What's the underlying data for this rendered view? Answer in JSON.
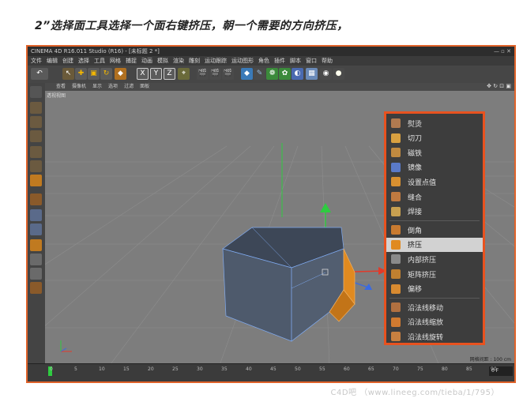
{
  "caption": "2”选择面工具选择一个面右键挤压，朝一个需要的方向挤压，",
  "window": {
    "title": "CINEMA 4D R16.011 Studio (R16) - [未标题 2 *]",
    "controls": "— ▫ ✕"
  },
  "menubar": [
    "文件",
    "编辑",
    "创建",
    "选择",
    "工具",
    "网格",
    "捕捉",
    "动画",
    "模拟",
    "渲染",
    "雕刻",
    "运动跟踪",
    "运动图形",
    "角色",
    "插件",
    "脚本",
    "窗口",
    "帮助"
  ],
  "toolbar": {
    "axis_x": "X",
    "axis_y": "Y",
    "axis_z": "Z"
  },
  "viewport": {
    "menu": [
      "查看",
      "摄像机",
      "显示",
      "选项",
      "过滤",
      "面板"
    ],
    "tag": "透视视图",
    "grid_label": "网格间距 : 100 cm",
    "nav_icons": "✥ ↻ ⊡ ▣"
  },
  "timeline": {
    "ticks": [
      "0",
      "5",
      "10",
      "15",
      "20",
      "25",
      "30",
      "35",
      "40",
      "45",
      "50",
      "55",
      "60",
      "65",
      "70",
      "75",
      "80",
      "85",
      "90"
    ],
    "frame_field": "0 F"
  },
  "context_menu": {
    "groups": [
      [
        {
          "label": "熨烫",
          "icon": "iron-icon"
        },
        {
          "label": "切刀",
          "icon": "knife-icon"
        },
        {
          "label": "磁铁",
          "icon": "magnet-icon"
        },
        {
          "label": "镜像",
          "icon": "mirror-icon"
        },
        {
          "label": "设置点值",
          "icon": "set-point-value-icon"
        },
        {
          "label": "缝合",
          "icon": "stitch-icon"
        },
        {
          "label": "焊接",
          "icon": "weld-icon"
        }
      ],
      [
        {
          "label": "倒角",
          "icon": "bevel-icon"
        },
        {
          "label": "挤压",
          "icon": "extrude-icon",
          "selected": true
        },
        {
          "label": "内部挤压",
          "icon": "extrude-inner-icon"
        },
        {
          "label": "矩阵挤压",
          "icon": "matrix-extrude-icon"
        },
        {
          "label": "偏移",
          "icon": "offset-icon"
        }
      ],
      [
        {
          "label": "沿法线移动",
          "icon": "normal-move-icon"
        },
        {
          "label": "沿法线缩放",
          "icon": "normal-scale-icon"
        },
        {
          "label": "沿法线旋转",
          "icon": "normal-rotate-icon"
        }
      ]
    ]
  },
  "watermark": "C4D吧 （www.lineeg.com/tieba/1/795）",
  "colors": {
    "highlight_border": "#e8521f",
    "frame_border": "#e0632a",
    "viewport_bg": "#7e7e7e",
    "object_face": "#4a5566",
    "selected_face": "#e08a20"
  }
}
